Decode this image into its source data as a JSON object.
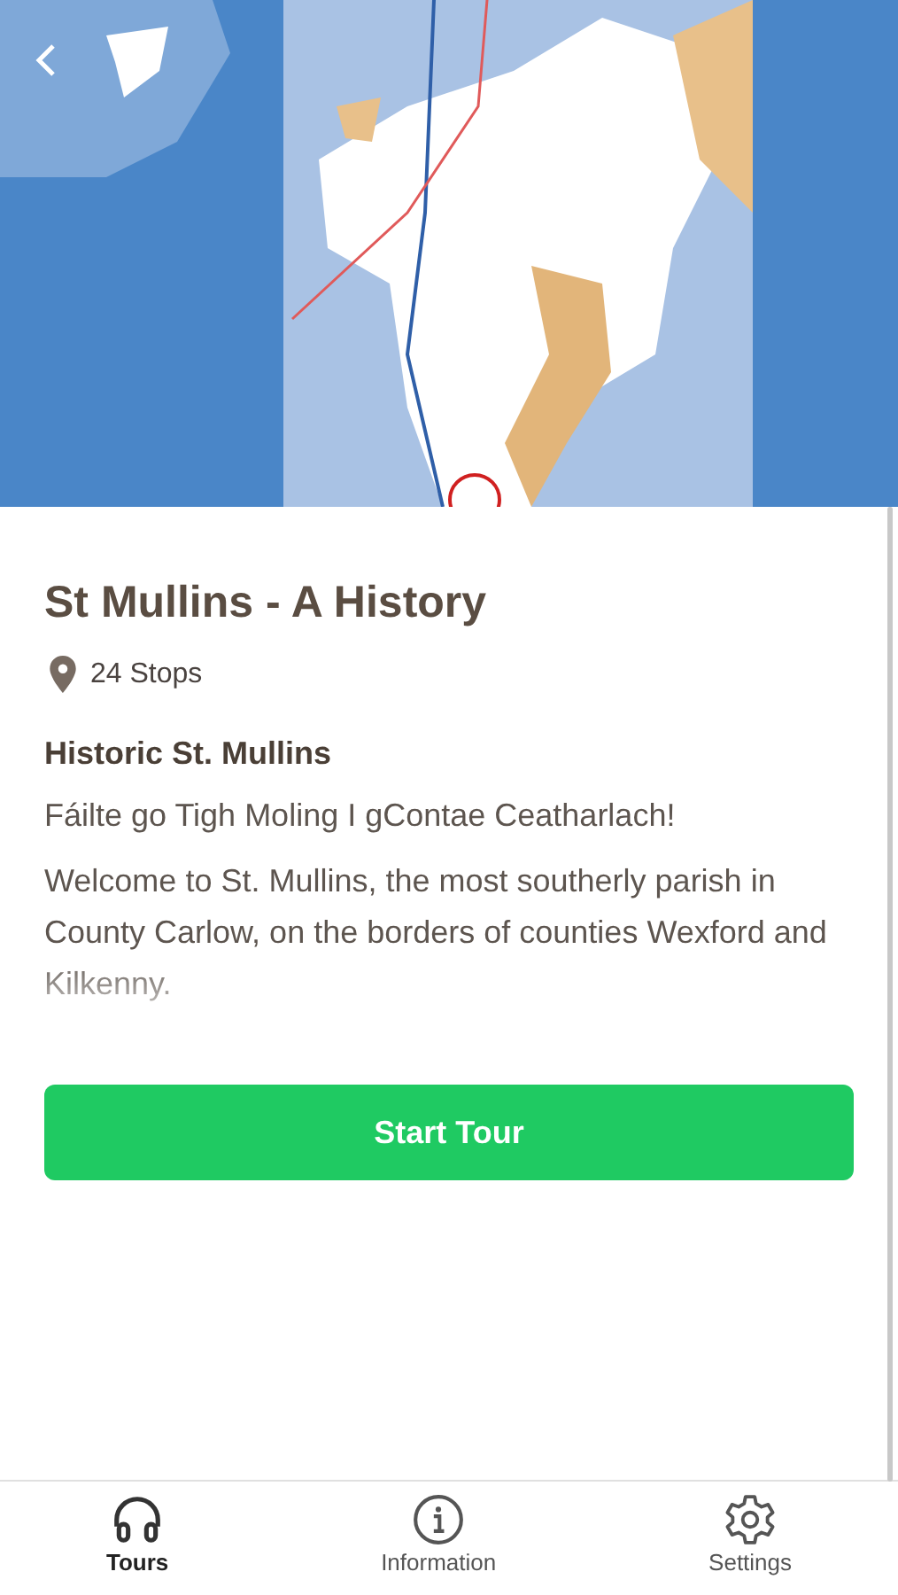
{
  "tour": {
    "title": "St Mullins - A History",
    "stops": "24 Stops",
    "subtitle": "Historic St. Mullins",
    "paragraphs": [
      "Fáilte go Tigh Moling I gContae Ceatharlach!",
      "Welcome to St. Mullins, the most southerly parish in County Carlow, on the borders of counties Wexford and Kilkenny."
    ]
  },
  "start_button": "Start Tour",
  "tabs": [
    {
      "label": "Tours",
      "selected": true
    },
    {
      "label": "Information",
      "selected": false
    },
    {
      "label": "Settings",
      "selected": false
    }
  ]
}
